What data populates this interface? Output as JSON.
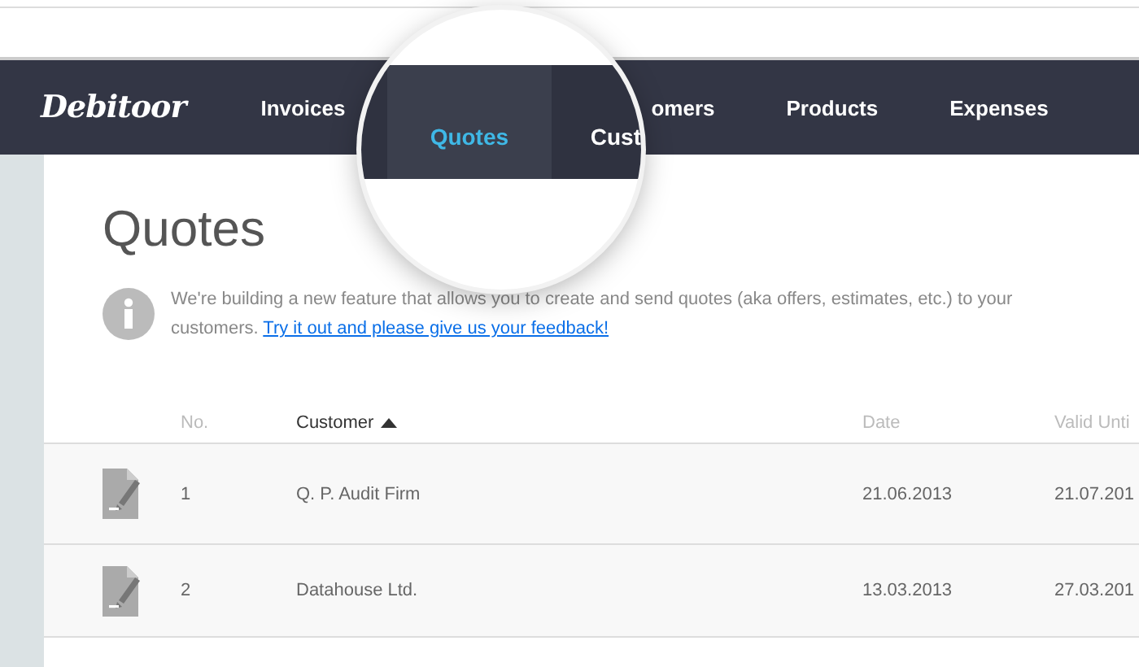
{
  "nav": {
    "logo": "Debitoor",
    "items": [
      {
        "label": "Invoices",
        "selected": false
      },
      {
        "label": "omers",
        "selected": false
      },
      {
        "label": "Products",
        "selected": false
      },
      {
        "label": "Expenses",
        "selected": false
      }
    ]
  },
  "magnifier": {
    "items": [
      {
        "label": "Quotes",
        "selected": true
      },
      {
        "label": "Cust",
        "selected": false
      }
    ]
  },
  "page": {
    "title": "Quotes",
    "notice": "We're building a new feature that allows you to create and send quotes (aka offers, estimates, etc.) to your customers.",
    "notice_link": "Try it out and please give us your feedback!"
  },
  "table": {
    "columns": [
      {
        "label": "No.",
        "sorted": false
      },
      {
        "label": "Customer",
        "sorted": true
      },
      {
        "label": "Date",
        "sorted": false
      },
      {
        "label": "Valid Unti",
        "sorted": false
      }
    ],
    "rows": [
      {
        "no": "1",
        "customer": "Q. P. Audit Firm",
        "date": "21.06.2013",
        "valid": "21.07.201"
      },
      {
        "no": "2",
        "customer": "Datahouse Ltd.",
        "date": "13.03.2013",
        "valid": "27.03.201"
      }
    ]
  }
}
